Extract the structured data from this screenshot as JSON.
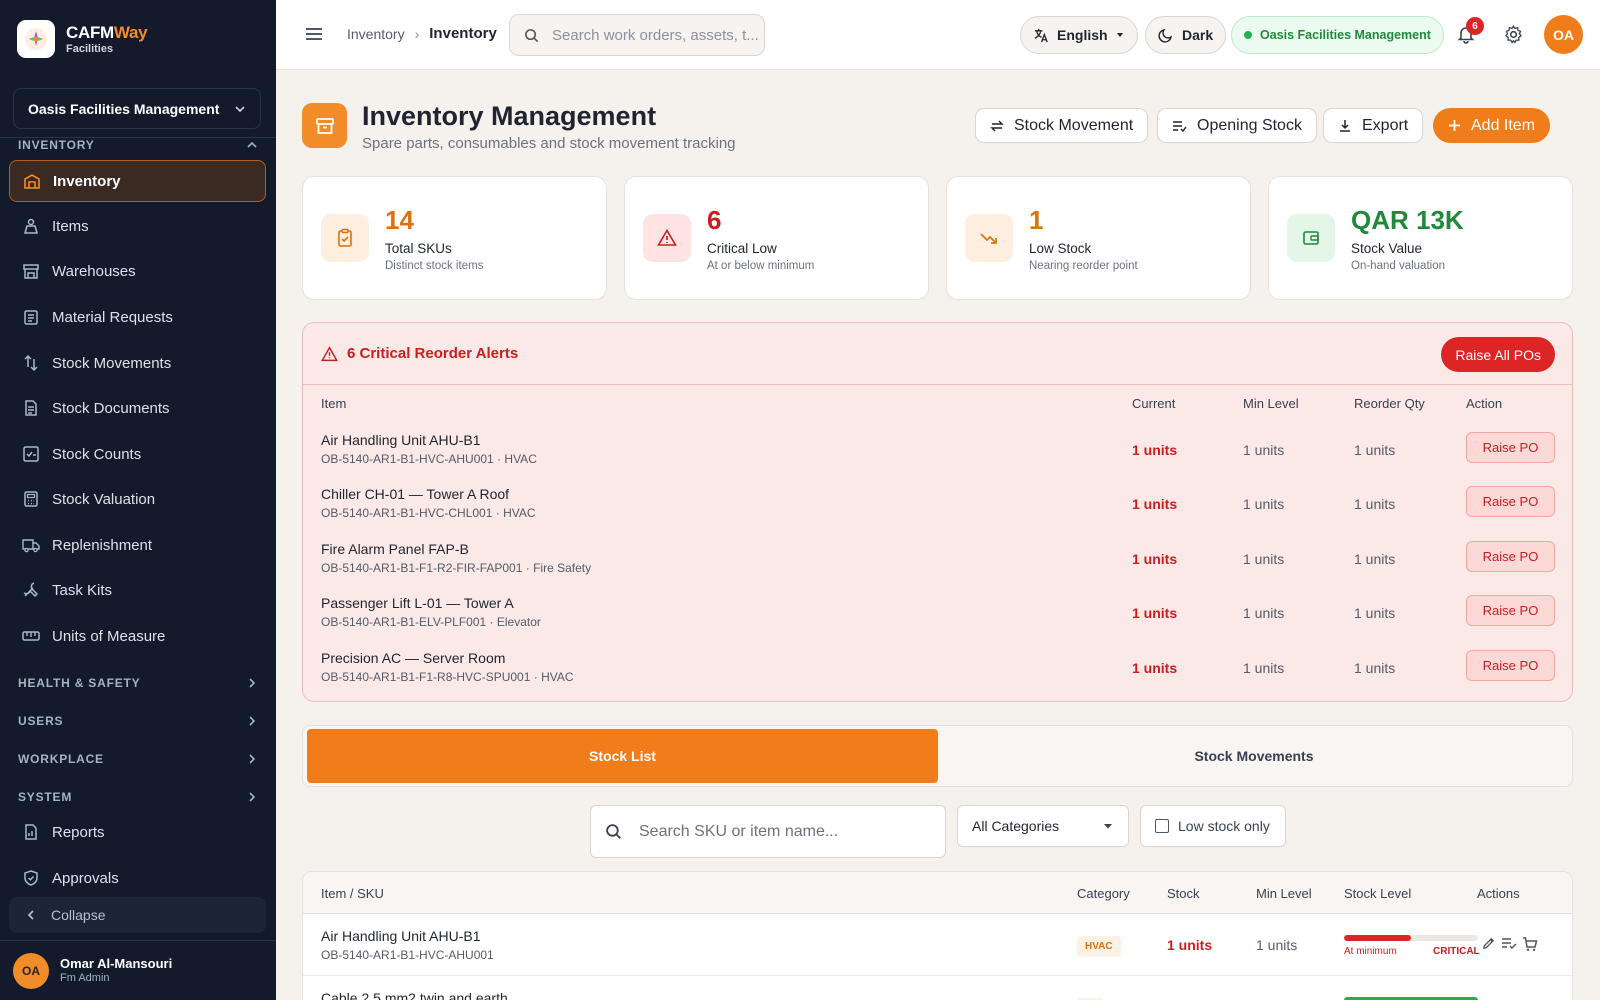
{
  "brand": {
    "name_a": "CAFM",
    "name_b": "Way",
    "sub": "Facilities"
  },
  "org_select": "Oasis Facilities Management",
  "sidebar": {
    "section_inventory": "INVENTORY",
    "items": [
      {
        "label": "Inventory",
        "icon": "warehouse-icon",
        "active": true
      },
      {
        "label": "Items",
        "icon": "scale-icon"
      },
      {
        "label": "Warehouses",
        "icon": "store-icon"
      },
      {
        "label": "Material Requests",
        "icon": "clipboard-icon"
      },
      {
        "label": "Stock Movements",
        "icon": "arrows-vertical-icon"
      },
      {
        "label": "Stock Documents",
        "icon": "document-icon"
      },
      {
        "label": "Stock Counts",
        "icon": "checklist-icon"
      },
      {
        "label": "Stock Valuation",
        "icon": "calculator-icon"
      },
      {
        "label": "Replenishment",
        "icon": "truck-icon"
      },
      {
        "label": "Task Kits",
        "icon": "tools-icon"
      },
      {
        "label": "Units of Measure",
        "icon": "ruler-icon"
      }
    ],
    "groups": [
      "HEALTH & SAFETY",
      "USERS",
      "WORKPLACE",
      "SYSTEM"
    ],
    "bottom_items": [
      {
        "label": "Reports",
        "icon": "report-icon"
      },
      {
        "label": "Approvals",
        "icon": "shield-check-icon"
      }
    ],
    "collapse_label": "Collapse",
    "user": {
      "initials": "OA",
      "name": "Omar Al-Mansouri",
      "role": "Fm Admin"
    }
  },
  "topbar": {
    "breadcrumb_parent": "Inventory",
    "breadcrumb_current": "Inventory",
    "search_placeholder": "Search work orders, assets, t...",
    "language": "English",
    "theme": "Dark",
    "org": "Oasis Facilities Management",
    "notification_count": "6",
    "avatar_initials": "OA"
  },
  "page": {
    "title": "Inventory Management",
    "subtitle": "Spare parts, consumables and stock movement tracking",
    "buttons": {
      "stock_movement": "Stock Movement",
      "opening_stock": "Opening Stock",
      "export": "Export",
      "add_item": "Add Item"
    }
  },
  "kpis": [
    {
      "value": "14",
      "label": "Total SKUs",
      "sub": "Distinct stock items",
      "color": "#e0700f",
      "bg": "#fdeee0",
      "icon": "clipboard-check-icon"
    },
    {
      "value": "6",
      "label": "Critical Low",
      "sub": "At or below minimum",
      "color": "#c81e1e",
      "bg": "#fde4e2",
      "icon": "warning-icon"
    },
    {
      "value": "1",
      "label": "Low Stock",
      "sub": "Nearing reorder point",
      "color": "#d97706",
      "bg": "#fdeee0",
      "icon": "trending-down-icon"
    },
    {
      "value": "QAR 13K",
      "label": "Stock Value",
      "sub": "On-hand valuation",
      "color": "#1f8a3a",
      "bg": "#e3f6e8",
      "icon": "wallet-icon"
    }
  ],
  "alerts": {
    "title": "6 Critical Reorder Alerts",
    "raise_all": "Raise All POs",
    "headers": {
      "item": "Item",
      "current": "Current",
      "min": "Min Level",
      "reorder": "Reorder Qty",
      "action": "Action"
    },
    "rows": [
      {
        "name": "Air Handling Unit AHU-B1",
        "code": "OB-5140-AR1-B1-HVC-AHU001",
        "category": "HVAC",
        "current": "1 units",
        "min": "1 units",
        "reorder": "1 units",
        "action": "Raise PO"
      },
      {
        "name": "Chiller CH-01 — Tower A Roof",
        "code": "OB-5140-AR1-B1-HVC-CHL001",
        "category": "HVAC",
        "current": "1 units",
        "min": "1 units",
        "reorder": "1 units",
        "action": "Raise PO"
      },
      {
        "name": "Fire Alarm Panel FAP-B",
        "code": "OB-5140-AR1-B1-F1-R2-FIR-FAP001",
        "category": "Fire Safety",
        "current": "1 units",
        "min": "1 units",
        "reorder": "1 units",
        "action": "Raise PO"
      },
      {
        "name": "Passenger Lift L-01 — Tower A",
        "code": "OB-5140-AR1-B1-ELV-PLF001",
        "category": "Elevator",
        "current": "1 units",
        "min": "1 units",
        "reorder": "1 units",
        "action": "Raise PO"
      },
      {
        "name": "Precision AC — Server Room",
        "code": "OB-5140-AR1-B1-F1-R8-HVC-SPU001",
        "category": "HVAC",
        "current": "1 units",
        "min": "1 units",
        "reorder": "1 units",
        "action": "Raise PO"
      }
    ]
  },
  "tabs": [
    "Stock List",
    "Stock Movements"
  ],
  "filters": {
    "search_placeholder": "Search SKU or item name...",
    "category": "All Categories",
    "low_stock_label": "Low stock only"
  },
  "stock_table": {
    "headers": {
      "item": "Item / SKU",
      "category": "Category",
      "stock": "Stock",
      "min": "Min Level",
      "level": "Stock Level",
      "actions": "Actions"
    },
    "rows": [
      {
        "name": "Air Handling Unit AHU-B1",
        "sku": "OB-5140-AR1-B1-HVC-AHU001",
        "category": "HVAC",
        "stock": "1 units",
        "min": "1 units",
        "level": 0.5,
        "level_color": "#dc2626",
        "note": "At minimum",
        "status": "CRITICAL"
      },
      {
        "name": "Cable 2.5 mm2 twin and earth",
        "sku": "",
        "category": "",
        "stock": "",
        "min": "",
        "level": 1.0,
        "level_color": "#22b14c",
        "note": "",
        "status": ""
      }
    ]
  }
}
